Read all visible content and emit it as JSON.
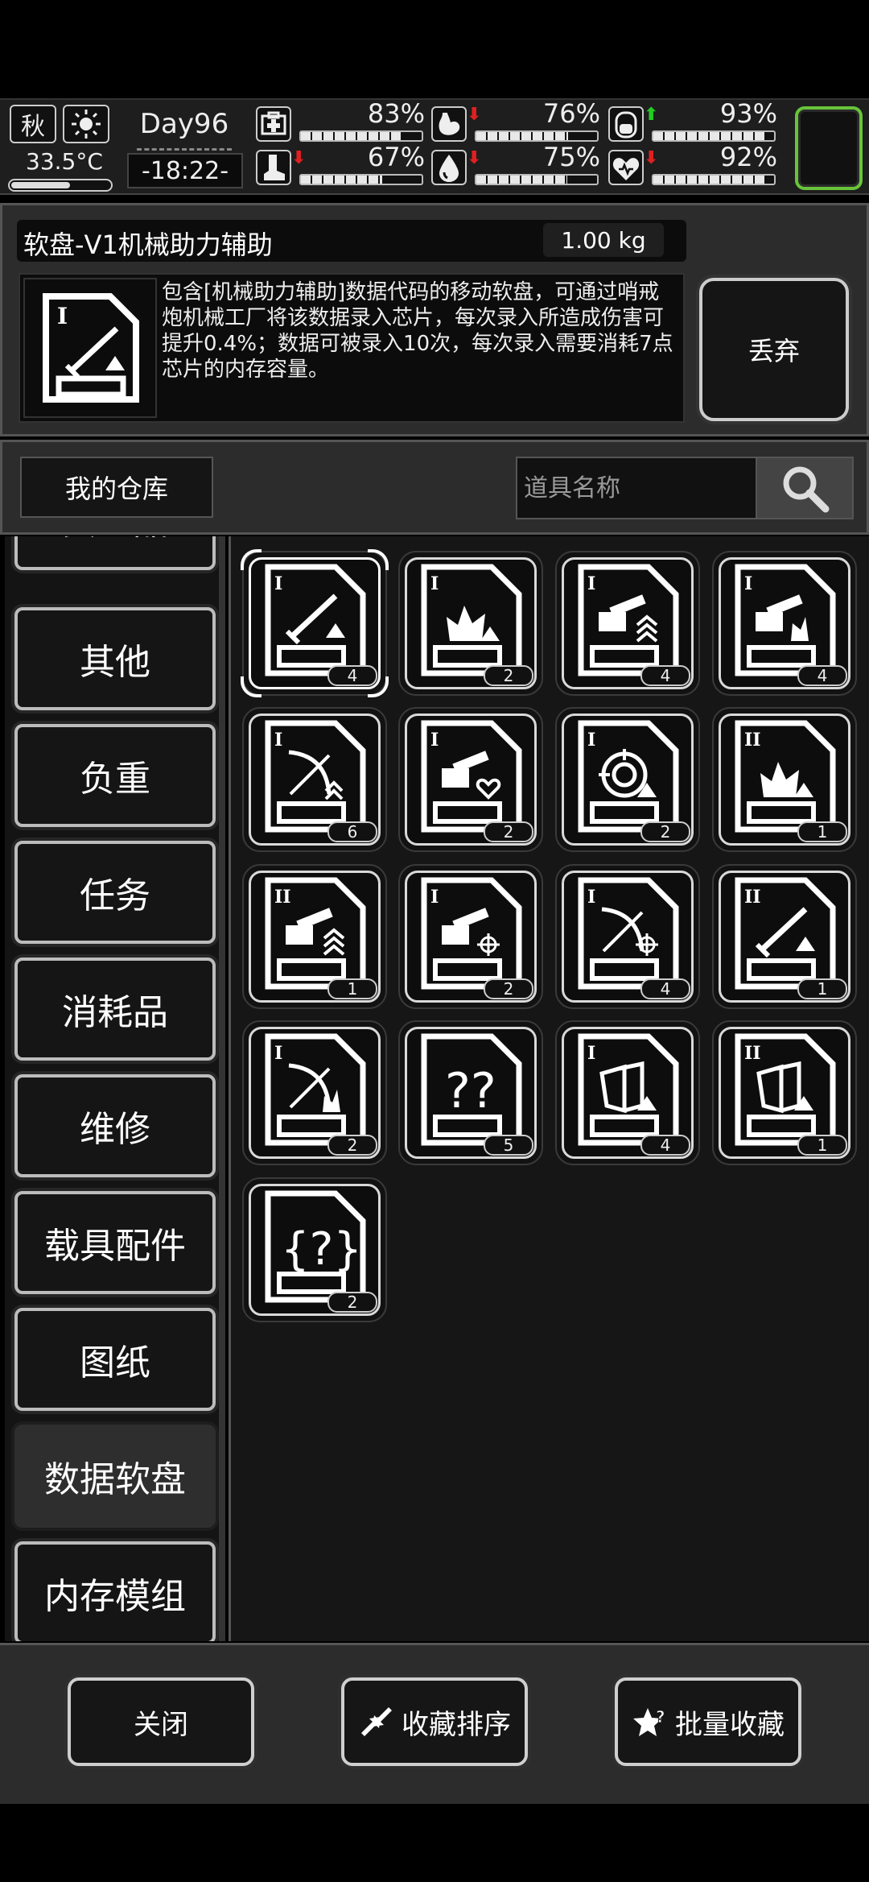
{
  "hud": {
    "season": "秋",
    "temperature": "33.5°C",
    "temperature_level": 0.6,
    "day": "Day96",
    "time": "-18:22-",
    "stats": [
      {
        "name": "health",
        "value": "83%",
        "level": 0.83,
        "trend": ""
      },
      {
        "name": "stomach",
        "value": "76%",
        "level": 0.76,
        "trend": "down"
      },
      {
        "name": "stamina",
        "value": "93%",
        "level": 0.93,
        "trend": "up"
      },
      {
        "name": "mobility",
        "value": "67%",
        "level": 0.67,
        "trend": "down"
      },
      {
        "name": "water",
        "value": "75%",
        "level": 0.75,
        "trend": "down"
      },
      {
        "name": "mood",
        "value": "92%",
        "level": 0.92,
        "trend": "down"
      }
    ],
    "colors": {
      "trend_down": "#e02020",
      "trend_up": "#22cc22",
      "slot_border": "#67c43a"
    }
  },
  "item": {
    "title": "软盘-V1机械助力辅助",
    "weight": "1.00 kg",
    "description": "包含[机械助力辅助]数据代码的移动软盘，可通过哨戒炮机械工厂将该数据录入芯片，每次录入所造成伤害可提升0.4%；数据可被录入10次，每次录入需要消耗7点芯片的内存容量。",
    "discard_label": "丢弃"
  },
  "warehouse": {
    "title": "我的仓库",
    "search_placeholder": "道具名称"
  },
  "categories": [
    {
      "label": "负重品",
      "active": false
    },
    {
      "label": "其他",
      "active": false
    },
    {
      "label": "负重",
      "active": false
    },
    {
      "label": "任务",
      "active": false
    },
    {
      "label": "消耗品",
      "active": false
    },
    {
      "label": "维修",
      "active": false
    },
    {
      "label": "载具配件",
      "active": false
    },
    {
      "label": "图纸",
      "active": false
    },
    {
      "label": "数据软盘",
      "active": true
    },
    {
      "label": "内存模组",
      "active": false
    }
  ],
  "items": [
    {
      "tier": "I",
      "icon": "sword",
      "count": "4",
      "selected": true
    },
    {
      "tier": "I",
      "icon": "burst",
      "count": "2"
    },
    {
      "tier": "I",
      "icon": "turret-chevron",
      "count": "4"
    },
    {
      "tier": "I",
      "icon": "turret-burst",
      "count": "4"
    },
    {
      "tier": "I",
      "icon": "bow-chevron",
      "count": "6"
    },
    {
      "tier": "I",
      "icon": "turret-heart",
      "count": "2"
    },
    {
      "tier": "I",
      "icon": "target",
      "count": "2"
    },
    {
      "tier": "II",
      "icon": "burst",
      "count": "1"
    },
    {
      "tier": "II",
      "icon": "turret-chevron",
      "count": "1"
    },
    {
      "tier": "I",
      "icon": "turret-crosshair",
      "count": "2"
    },
    {
      "tier": "I",
      "icon": "bow-crosshair",
      "count": "4"
    },
    {
      "tier": "II",
      "icon": "sword",
      "count": "1"
    },
    {
      "tier": "I",
      "icon": "bow-burst",
      "count": "2"
    },
    {
      "tier": "",
      "icon": "question",
      "count": "5"
    },
    {
      "tier": "I",
      "icon": "shield",
      "count": "4"
    },
    {
      "tier": "II",
      "icon": "shield",
      "count": "1"
    },
    {
      "tier": "",
      "icon": "question-bracket",
      "count": "2"
    }
  ],
  "bottom": {
    "close_label": "关闭",
    "sort_label": "收藏排序",
    "batch_label": "批量收藏"
  }
}
